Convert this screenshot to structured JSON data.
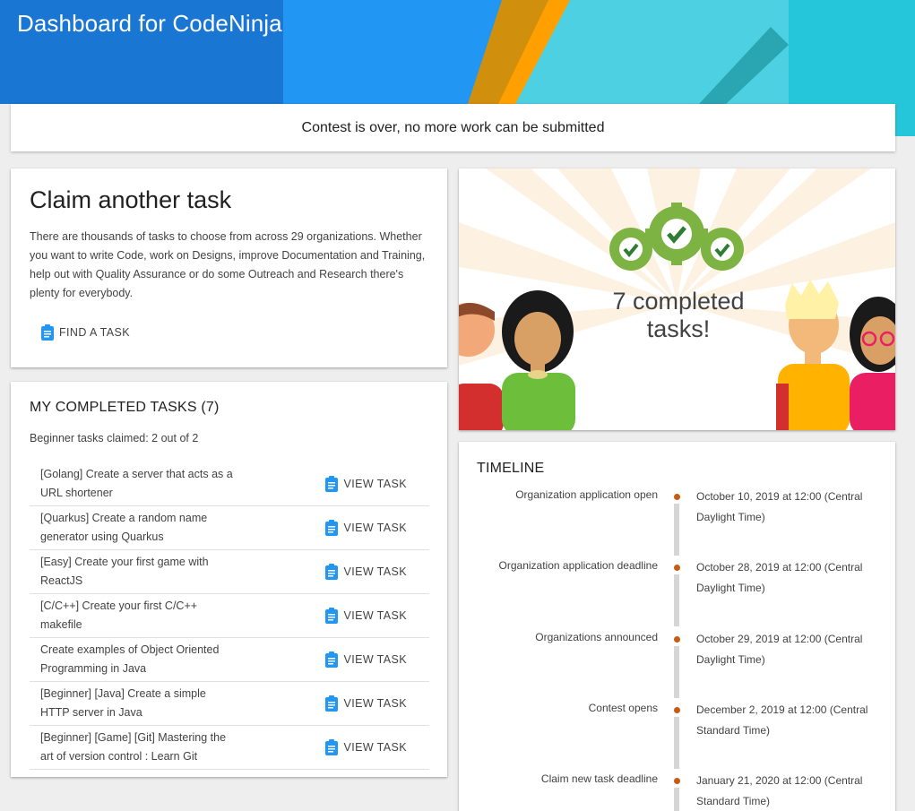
{
  "header": {
    "title": "Dashboard for CodeNinja"
  },
  "notice": {
    "text": "Contest is over, no more work can be submitted"
  },
  "claim": {
    "heading": "Claim another task",
    "description": "There are thousands of tasks to choose from across 29 organizations. Whether you want to write Code, work on Designs, improve Documentation and Training, help out with Quality Assurance or do some Outreach and Research there's plenty for everybody.",
    "button_label": "FIND A TASK"
  },
  "completed": {
    "heading": "MY COMPLETED TASKS (7)",
    "beginner_claimed": "Beginner tasks claimed: 2 out of 2",
    "view_label": "VIEW TASK",
    "tasks": [
      "[Golang] Create a server that acts as a URL shortener",
      "[Quarkus] Create a random name generator using Quarkus",
      "[Easy] Create your first game with ReactJS",
      "[C/C++] Create your first C/C++ makefile",
      "Create examples of Object Oriented Programming in Java",
      "[Beginner] [Java] Create a simple HTTP server in Java",
      "[Beginner] [Game] [Git] Mastering the art of version control : Learn Git"
    ]
  },
  "illustration": {
    "line1": "7 completed",
    "line2": "tasks!"
  },
  "timeline": {
    "heading": "TIMELINE",
    "events": [
      {
        "name": "Organization application open",
        "date": "October 10, 2019 at 12:00 (Central Daylight Time)"
      },
      {
        "name": "Organization application deadline",
        "date": "October 28, 2019 at 12:00 (Central Daylight Time)"
      },
      {
        "name": "Organizations announced",
        "date": "October 29, 2019 at 12:00 (Central Daylight Time)"
      },
      {
        "name": "Contest opens",
        "date": "December 2, 2019 at 12:00 (Central Standard Time)"
      },
      {
        "name": "Claim new task deadline",
        "date": "January 21, 2020 at 12:00 (Central Standard Time)"
      }
    ]
  },
  "colors": {
    "accent_blue": "#2196f3",
    "timeline_dot": "#c75b12",
    "badge_green": "#7cb342"
  },
  "icons": {
    "task_button": "clipboard-icon",
    "badge": "check-gear-icon"
  }
}
